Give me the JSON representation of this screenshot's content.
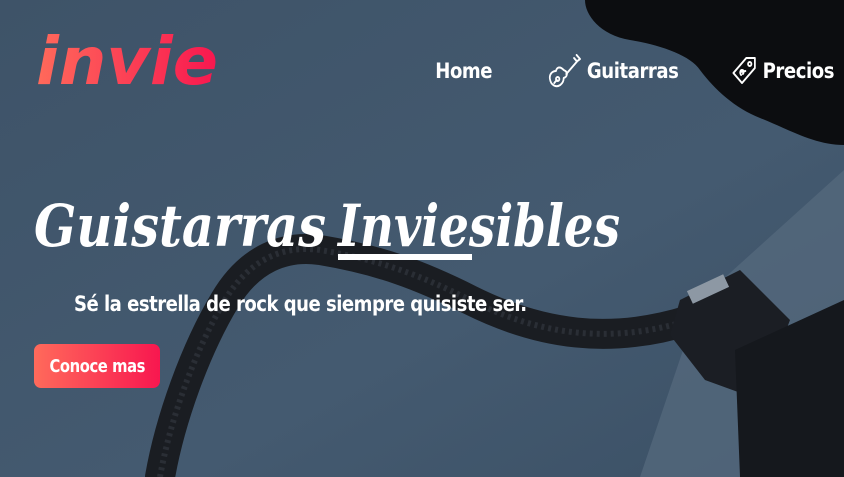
{
  "brand": {
    "logo_text": "invie",
    "gradient_start": "#ff6a5b",
    "gradient_end": "#f8174f"
  },
  "nav": {
    "items": [
      {
        "label": "Home",
        "icon": ""
      },
      {
        "label": "Guitarras",
        "icon": "guitar-icon"
      },
      {
        "label": "Precios",
        "icon": "price-tag-icon"
      }
    ]
  },
  "hero": {
    "title_part1": "Guistarras",
    "title_part2": "Inviesibles",
    "subtitle": "Sé la estrella de rock que siempre quisiste ser.",
    "cta_label": "Conoce mas",
    "background_color": "#41566c"
  }
}
